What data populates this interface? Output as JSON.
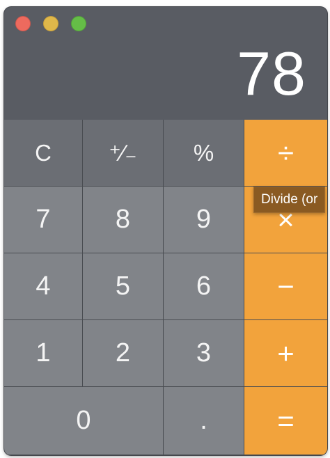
{
  "window": {
    "traffic_lights": {
      "close_color": "#ed6a5e",
      "minimize_color": "#e0b84a",
      "maximize_color": "#65bd47"
    }
  },
  "display": {
    "value": "78"
  },
  "keypad": {
    "rows": [
      [
        "C",
        "⁺∕₋",
        "%",
        "÷"
      ],
      [
        "7",
        "8",
        "9",
        "×"
      ],
      [
        "4",
        "5",
        "6",
        "−"
      ],
      [
        "1",
        "2",
        "3",
        "+"
      ],
      [
        "0",
        ".",
        "="
      ]
    ]
  },
  "tooltip": {
    "text": "Divide (or"
  },
  "colors": {
    "operator": "#f2a33c",
    "function_key": "#6b6e74",
    "number_key": "#818489",
    "display_bg": "#595c63"
  }
}
